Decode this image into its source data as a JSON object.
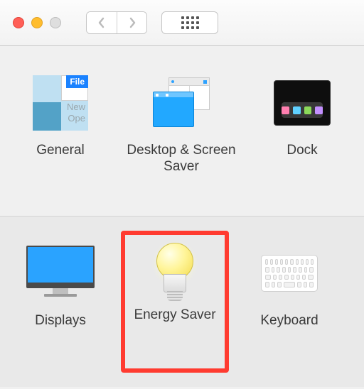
{
  "icons": {
    "general": {
      "file_tag": "File",
      "new_text": "New",
      "ops_text": "Ope"
    }
  },
  "row1": {
    "general_label": "General",
    "dss_label": "Desktop & Screen Saver",
    "dock_label": "Dock"
  },
  "row2": {
    "displays_label": "Displays",
    "energy_label": "Energy Saver",
    "keyboard_label": "Keyboard"
  },
  "highlight_target": "energy-saver"
}
